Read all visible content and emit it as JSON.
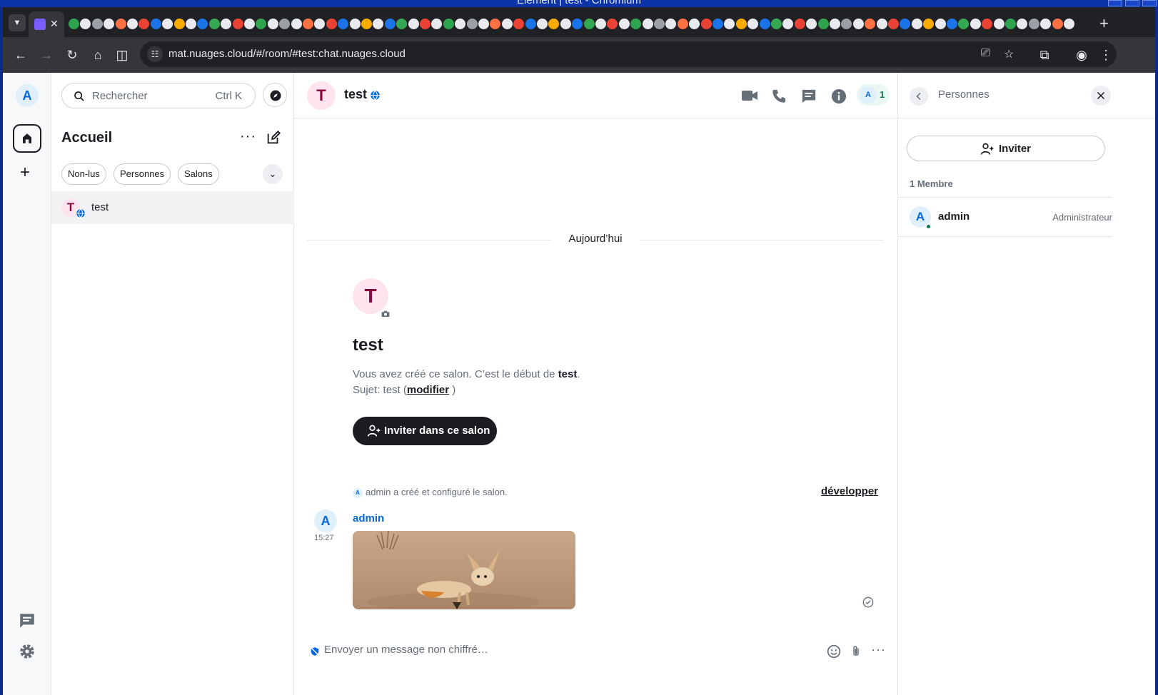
{
  "window": {
    "title": "Element | test - Chromium"
  },
  "browser": {
    "url": "mat.nuages.cloud/#/room/#test:chat.nuages.cloud",
    "new_tab": "+",
    "tab_close": "✕"
  },
  "spaces": {
    "user_initial": "A",
    "add_label": "+"
  },
  "roomlist": {
    "search_placeholder": "Rechercher",
    "search_shortcut": "Ctrl K",
    "title": "Accueil",
    "more": "···",
    "filters": [
      "Non-lus",
      "Personnes",
      "Salons"
    ],
    "rooms": [
      {
        "name": "test",
        "initial": "T"
      }
    ]
  },
  "room": {
    "name": "test",
    "initial": "T",
    "member_count": "1",
    "member_initial": "A",
    "date_separator": "Aujourd’hui",
    "intro": {
      "title": "test",
      "line1_prefix": "Vous avez créé ce salon. C’est le début de ",
      "line1_room": "test",
      "line1_suffix": ".",
      "topic_prefix": "Sujet: test (",
      "topic_link": "modifier",
      "topic_suffix": " )",
      "invite_button": "Inviter dans ce salon"
    },
    "event_summary": {
      "mini_initial": "A",
      "text": "admin a créé et configuré le salon.",
      "expand": "développer"
    },
    "message": {
      "sender": "admin",
      "initial": "A",
      "time": "15:27"
    },
    "composer_placeholder": "Envoyer un message non chiffré…"
  },
  "people": {
    "title": "Personnes",
    "invite_button": "Inviter",
    "member_count_label": "1 Membre",
    "members": [
      {
        "name": "admin",
        "initial": "A",
        "role": "Administrateur"
      }
    ]
  },
  "colors": {
    "accent": "#0467dd",
    "online": "#0b7a51",
    "room_avatar_bg": "#fde4ee",
    "room_avatar_fg": "#8b0a3d"
  }
}
